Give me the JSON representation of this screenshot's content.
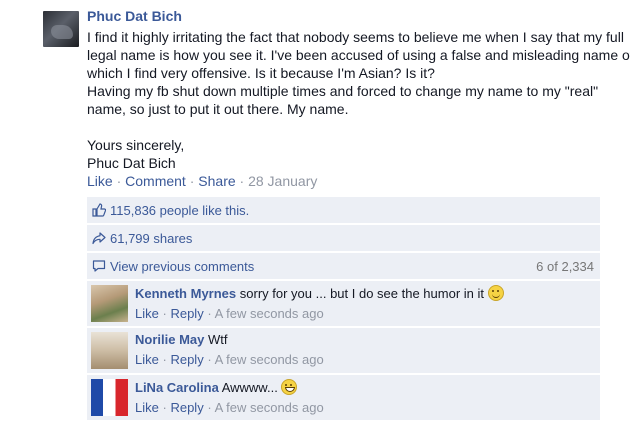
{
  "post": {
    "author": "Phuc Dat Bich",
    "lines": [
      "I find it highly irritating the fact that nobody seems to believe me when I say that my full",
      "legal name is how you see it. I've been accused of using a false and misleading name of",
      "which I find very offensive. Is it because I'm Asian? Is it?",
      "Having my fb shut down multiple times and forced to change my name to my \"real\"",
      "name, so just to put it out there. My name."
    ],
    "signoff": "Yours sincerely,",
    "signature": "Phuc Dat Bich",
    "actions": {
      "like": "Like",
      "comment": "Comment",
      "share": "Share",
      "date": "28 January",
      "separator": "·"
    }
  },
  "ufi": {
    "likes": "115,836 people like this.",
    "shares": "61,799 shares",
    "view_previous": "View previous comments",
    "comment_count": "6 of 2,334"
  },
  "comments": [
    {
      "name": "Kenneth Myrnes",
      "text": "sorry for you ... but I do see the humor in it",
      "emoji": "smile-emoji",
      "like": "Like",
      "reply": "Reply",
      "time": "A few seconds ago"
    },
    {
      "name": "Norilie May",
      "text": "Wtf",
      "like": "Like",
      "reply": "Reply",
      "time": "A few seconds ago"
    },
    {
      "name": "LiNa Carolina",
      "text": "Awwww...",
      "emoji": "grin-emoji",
      "like": "Like",
      "reply": "Reply",
      "time": "A few seconds ago"
    }
  ],
  "colors": {
    "link": "#3b5998",
    "meta": "#9197a3",
    "ufi_background": "#eceff5"
  }
}
